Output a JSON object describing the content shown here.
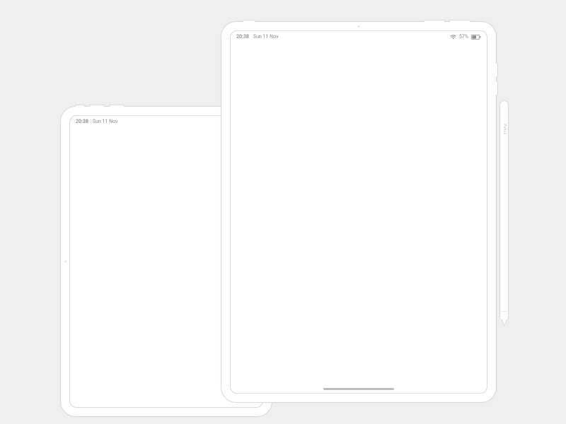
{
  "devices": {
    "small": {
      "statusbar": {
        "time": "20:38",
        "date": "Sun 11 Nov"
      }
    },
    "large": {
      "statusbar": {
        "time": "20:38",
        "date": "Sun 11 Nov",
        "battery_pct": "57%"
      }
    }
  },
  "pencil": {
    "brand_glyph": "",
    "label": "Pencil"
  }
}
